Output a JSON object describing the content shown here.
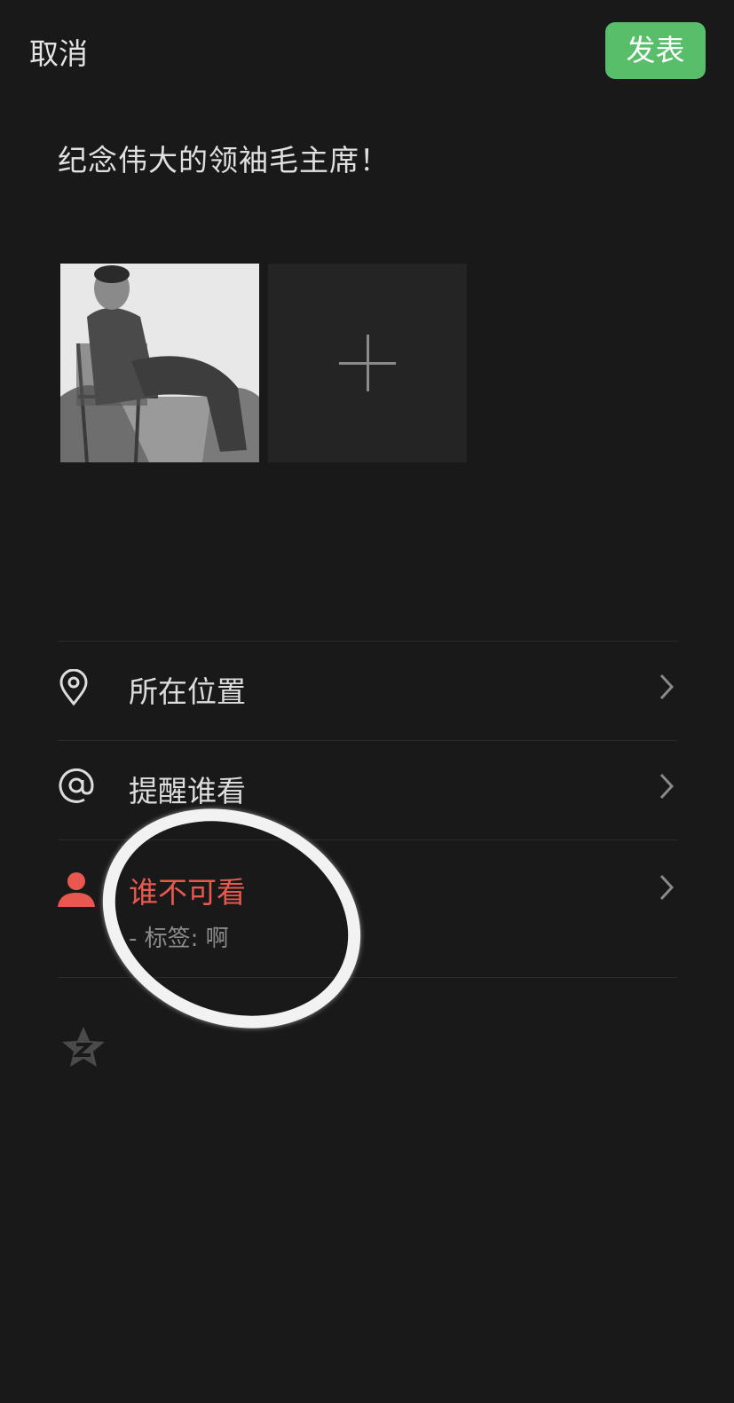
{
  "header": {
    "cancel_label": "取消",
    "publish_label": "发表"
  },
  "post": {
    "text": "纪念伟大的领袖毛主席！"
  },
  "media": {
    "add_icon": "plus-icon"
  },
  "options": {
    "location": {
      "label": "所在位置",
      "icon": "location-pin-icon"
    },
    "mention": {
      "label": "提醒谁看",
      "icon": "at-icon"
    },
    "visibility": {
      "label": "谁不可看",
      "sublabel": "- 标签: 啊",
      "icon": "person-icon"
    },
    "qzone": {
      "icon": "qzone-star-icon"
    }
  },
  "colors": {
    "background": "#191919",
    "publish_button": "#58be6a",
    "highlight_red": "#e8584f"
  }
}
